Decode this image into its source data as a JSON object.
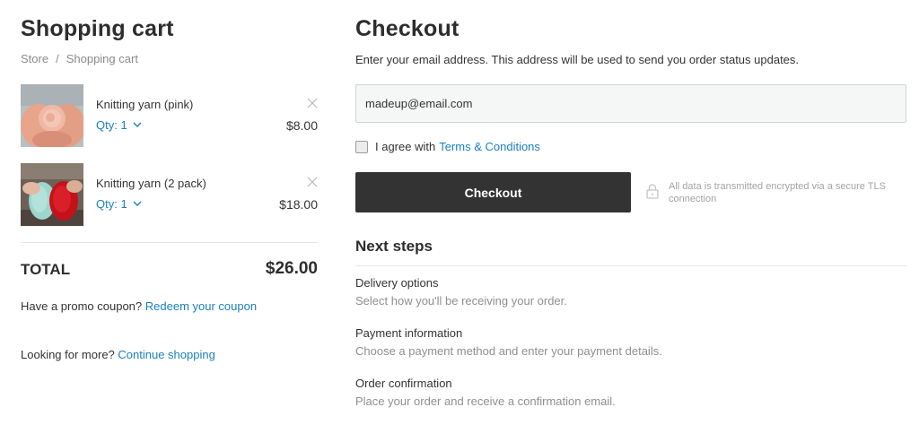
{
  "cart": {
    "title": "Shopping cart",
    "breadcrumb": [
      "Store",
      "Shopping cart"
    ],
    "breadcrumb_separator": "/",
    "items": [
      {
        "name": "Knitting yarn (pink)",
        "qty_label": "Qty: 1",
        "price": "$8.00"
      },
      {
        "name": "Knitting yarn (2 pack)",
        "qty_label": "Qty: 1",
        "price": "$18.00"
      }
    ],
    "total_label": "TOTAL",
    "total_value": "$26.00",
    "promo_text": "Have a promo coupon?",
    "promo_link": "Redeem your coupon",
    "more_text": "Looking for more?",
    "more_link": "Continue shopping"
  },
  "checkout": {
    "title": "Checkout",
    "description": "Enter your email address. This address will be used to send you order status updates.",
    "email_value": "madeup@email.com",
    "agree_text": "I agree with",
    "terms_link": "Terms & Conditions",
    "terms_checked": false,
    "button_label": "Checkout",
    "secure_note": "All data is transmitted encrypted via a secure TLS connection"
  },
  "next_steps": {
    "title": "Next steps",
    "steps": [
      {
        "title": "Delivery options",
        "description": "Select how you'll be receiving your order."
      },
      {
        "title": "Payment information",
        "description": "Choose a payment method and enter your payment details."
      },
      {
        "title": "Order confirmation",
        "description": "Place your order and receive a confirmation email."
      }
    ]
  },
  "colors": {
    "link": "#1a7fc1",
    "button": "#333333",
    "text": "#333333",
    "muted": "#8f8f8f"
  },
  "icons": [
    "chevron-down-icon",
    "close-icon",
    "lock-icon"
  ]
}
